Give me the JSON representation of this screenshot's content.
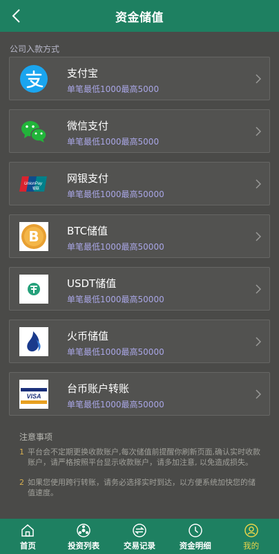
{
  "header": {
    "title": "资金储值"
  },
  "section_label": "公司入款方式",
  "methods": [
    {
      "name": "支付宝",
      "limit": "单笔最低1000最高5000",
      "icon": "alipay-icon"
    },
    {
      "name": "微信支付",
      "limit": "单笔最低1000最高5000",
      "icon": "wechat-icon"
    },
    {
      "name": "网银支付",
      "limit": "单笔最低1000最高50000",
      "icon": "unionpay-icon"
    },
    {
      "name": "BTC储值",
      "limit": "单笔最低1000最高50000",
      "icon": "bitcoin-icon"
    },
    {
      "name": "USDT储值",
      "limit": "单笔最低1000最高50000",
      "icon": "usdt-icon"
    },
    {
      "name": "火币储值",
      "limit": "单笔最低1000最高50000",
      "icon": "huobi-icon"
    },
    {
      "name": "台币账户转账",
      "limit": "单笔最低1000最高50000",
      "icon": "visa-icon"
    }
  ],
  "notes": {
    "title": "注意事项",
    "items": [
      {
        "num": "1",
        "text": "平台会不定期更换收款账户,每次储值前提醒你刷新页面,确认实时收款账户，请严格按照平台显示收款账户，请多加注意, 以免造成损失。"
      },
      {
        "num": "2",
        "text": "如果您使用跨行转账，请务必选择实时到达，以方便系统加快您的储值速度。"
      }
    ]
  },
  "tabbar": [
    {
      "label": "首页",
      "icon": "home-icon",
      "active": false
    },
    {
      "label": "投资列表",
      "icon": "invest-list-icon",
      "active": false
    },
    {
      "label": "交易记录",
      "icon": "transactions-icon",
      "active": false
    },
    {
      "label": "资金明细",
      "icon": "clock-icon",
      "active": false
    },
    {
      "label": "我的",
      "icon": "profile-icon",
      "active": true
    }
  ],
  "colors": {
    "header": "#1e8061",
    "background": "#4a4a48",
    "limit_text": "#a9a6e6",
    "active_tab": "#e8d44a"
  }
}
